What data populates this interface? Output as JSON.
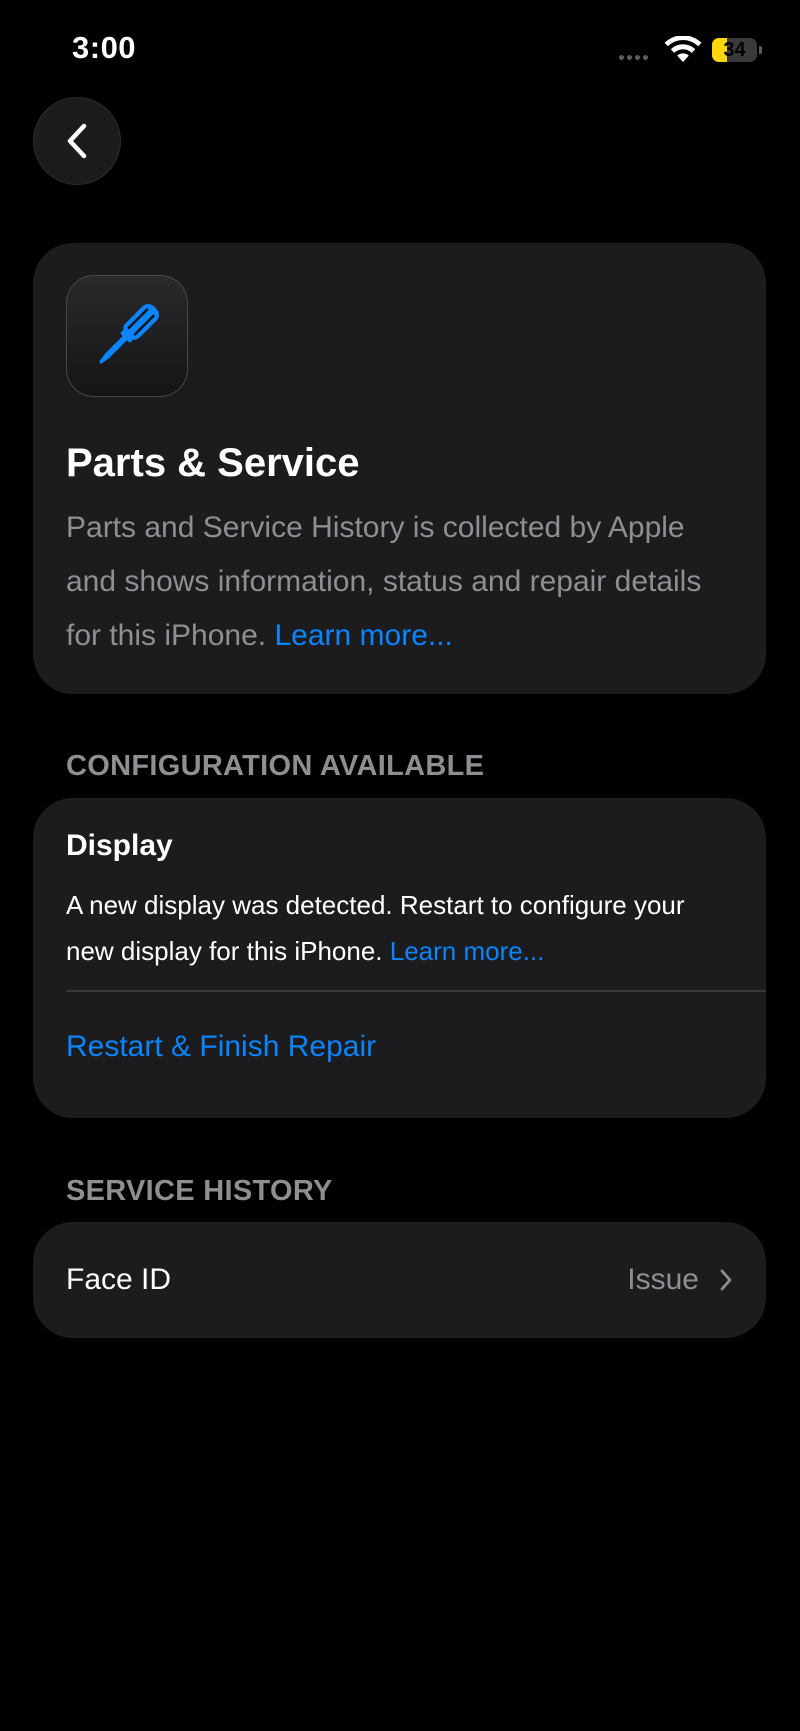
{
  "status_bar": {
    "time": "3:00",
    "battery_level": "34",
    "battery_fraction": 0.34
  },
  "nav": {
    "back_icon": "chevron-left-icon"
  },
  "intro": {
    "icon": "screwdriver-icon",
    "title": "Parts & Service",
    "body": "Parts and Service History is collected by Apple and shows information, status and repair details for this iPhone.",
    "link": "Learn more..."
  },
  "configuration": {
    "header": "CONFIGURATION AVAILABLE",
    "title": "Display",
    "body": "A new display was detected. Restart to configure your new display for this iPhone.",
    "link": "Learn more...",
    "action": "Restart & Finish Repair"
  },
  "service_history": {
    "header": "SERVICE HISTORY",
    "items": [
      {
        "label": "Face ID",
        "status": "Issue"
      }
    ]
  },
  "colors": {
    "background": "#000000",
    "card": "#1c1c1e",
    "accent": "#0a84ff",
    "secondary_text": "#8e8e93",
    "battery": "#ffd60a"
  }
}
